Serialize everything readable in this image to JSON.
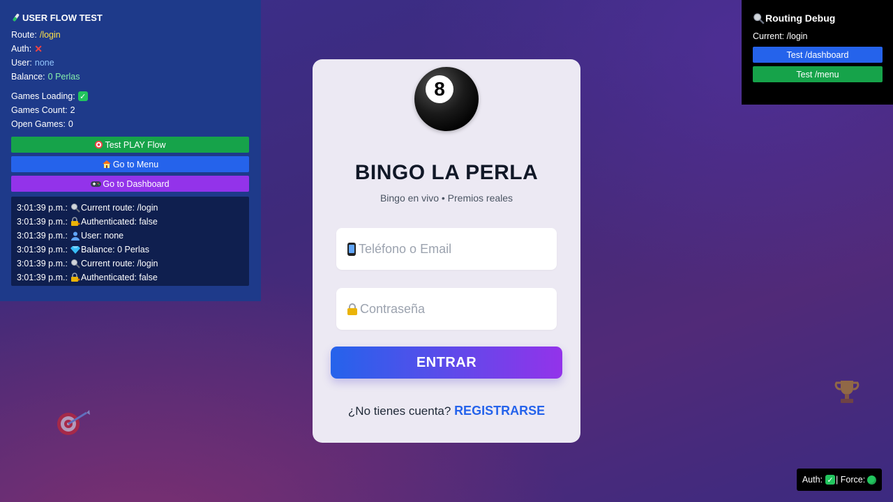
{
  "debug_panel": {
    "title": "USER FLOW TEST",
    "title_icon": "test-tube-icon",
    "route_label": "Route:",
    "route_value": "/login",
    "auth_label": "Auth:",
    "auth_value": "✕",
    "user_label": "User:",
    "user_value": "none",
    "balance_label": "Balance:",
    "balance_value": "0 Perlas",
    "games_loading_label": "Games Loading:",
    "games_loading_value": "✓",
    "games_count_label": "Games Count:",
    "games_count_value": "2",
    "open_games_label": "Open Games:",
    "open_games_value": "0",
    "buttons": {
      "test_play": "Test PLAY Flow",
      "go_menu": "Go to Menu",
      "go_dashboard": "Go to Dashboard"
    },
    "log": [
      {
        "time": "3:01:39 p.m.:",
        "icon": "magnifier-icon",
        "text": "Current route: /login"
      },
      {
        "time": "3:01:39 p.m.:",
        "icon": "lock-key-icon",
        "text": "Authenticated: false"
      },
      {
        "time": "3:01:39 p.m.:",
        "icon": "user-icon",
        "text": "User: none"
      },
      {
        "time": "3:01:39 p.m.:",
        "icon": "gem-icon",
        "text": "Balance: 0 Perlas"
      },
      {
        "time": "3:01:39 p.m.:",
        "icon": "magnifier-icon",
        "text": "Current route: /login"
      },
      {
        "time": "3:01:39 p.m.:",
        "icon": "lock-key-icon",
        "text": "Authenticated: false"
      }
    ]
  },
  "routing_panel": {
    "title": "Routing Debug",
    "current": "Current: /login",
    "btn_dashboard": "Test /dashboard",
    "btn_menu": "Test /menu"
  },
  "login": {
    "ball_number": "8",
    "title": "BINGO LA PERLA",
    "subtitle": "Bingo en vivo • Premios reales",
    "identifier_placeholder": "Teléfono o Email",
    "password_placeholder": "Contraseña",
    "submit_label": "ENTRAR",
    "register_prompt": "¿No tienes cuenta?",
    "register_link": "REGISTRARSE"
  },
  "auth_badge": {
    "auth_label": "Auth:",
    "auth_value": "✓",
    "force_label": "| Force:",
    "force_status": "green-dot-icon"
  },
  "colors": {
    "debug_bg": "#1e3a8a",
    "accent_blue": "#2563eb",
    "accent_green": "#16a34a",
    "accent_purple": "#9333ea"
  }
}
